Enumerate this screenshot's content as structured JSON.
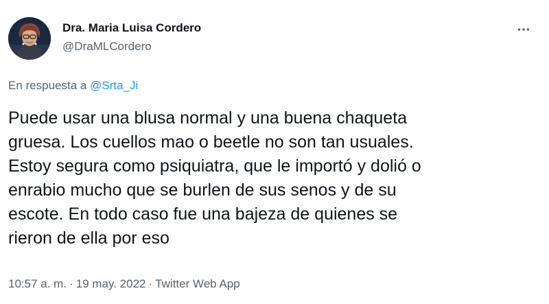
{
  "author": {
    "display_name": "Dra. Maria Luisa Cordero",
    "handle": "@DraMLCordero",
    "avatar_icon": "profile-photo"
  },
  "more_icon": "more-options-icon",
  "reply": {
    "prefix": "En respuesta a",
    "mention": "@Srta_Ji"
  },
  "text_lines": [
    "Puede usar una blusa normal y una buena chaqueta",
    "gruesa. Los cuellos mao o beetle no son tan usuales.",
    "Estoy segura como psiquiatra, que le importó y dolió o",
    "enrabio mucho que se burlen de sus senos y de su",
    "escote. En todo caso fue una bajeza de quienes se",
    "rieron de ella por eso"
  ],
  "meta": {
    "time": "10:57 a. m.",
    "separator": "·",
    "date": "19 may. 2022",
    "source": "Twitter Web App"
  },
  "colors": {
    "text": "#0f1419",
    "secondary": "#536471",
    "link": "#1d9bf0"
  }
}
